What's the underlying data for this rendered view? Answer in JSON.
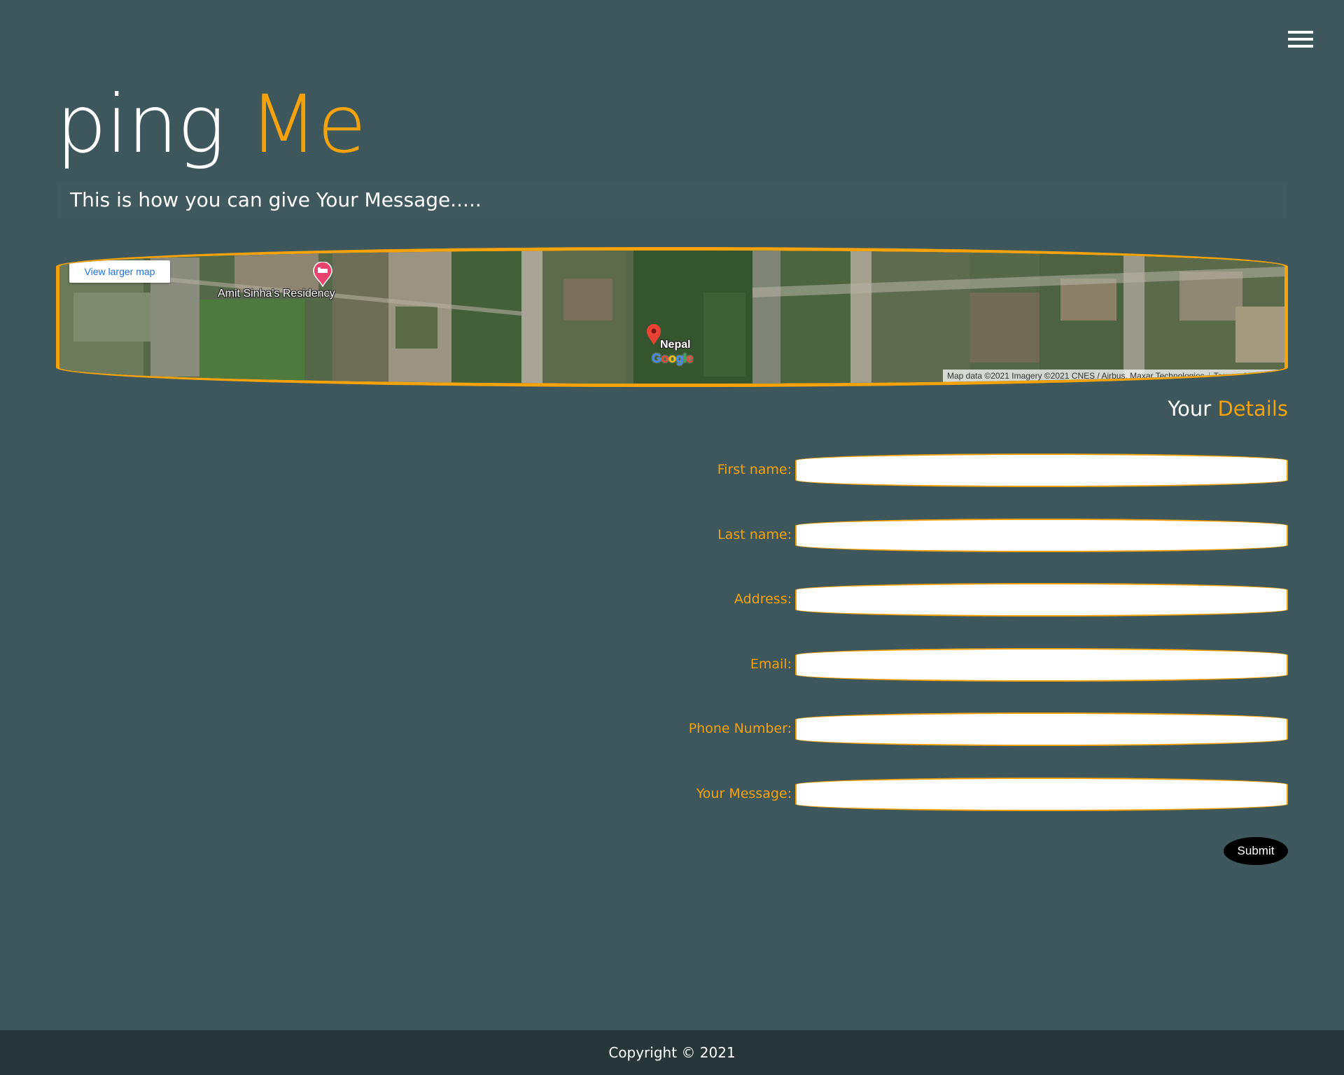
{
  "header": {
    "menu_icon": "hamburger-menu-icon"
  },
  "brand": {
    "word1": "ping",
    "word2": "Me",
    "accent_color": "#f5a20b"
  },
  "tagline": "This is how you can give Your Message.....",
  "map": {
    "view_larger_label": "View larger map",
    "places": [
      {
        "label": "Amit Sinha's Residency",
        "icon": "hotel-pin-icon"
      },
      {
        "label": "Nepal",
        "icon": "red-location-pin-icon"
      }
    ],
    "logo": "Google",
    "attribution": "Map data ©2021 Imagery ©2021 CNES / Airbus, Maxar Technologies",
    "terms": "Terms of Use"
  },
  "details": {
    "title_word1": "Your",
    "title_word2": "Details"
  },
  "form": {
    "fields": [
      {
        "label": "First name:",
        "value": ""
      },
      {
        "label": "Last name:",
        "value": ""
      },
      {
        "label": "Address:",
        "value": ""
      },
      {
        "label": "Email:",
        "value": ""
      },
      {
        "label": "Phone Number:",
        "value": ""
      },
      {
        "label": "Your Message:",
        "value": ""
      }
    ],
    "submit_label": "Submit"
  },
  "footer": {
    "copyright": "Copyright © 2021"
  },
  "colors": {
    "background": "#3d575c",
    "accent": "#f5a20b",
    "footer_background": "#263639"
  }
}
